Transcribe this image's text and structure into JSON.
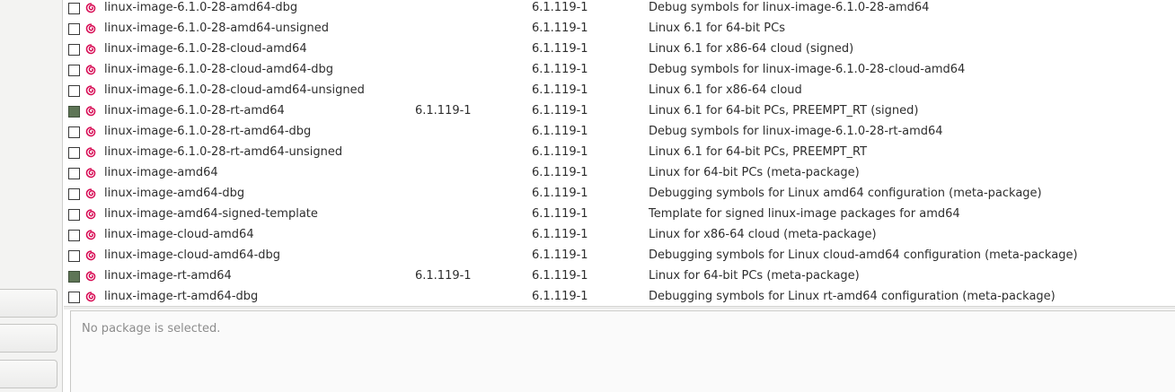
{
  "packages": [
    {
      "checked": false,
      "name": "linux-image-6.1.0-28-amd64-dbg",
      "installed": "",
      "latest": "6.1.119-1",
      "description": "Debug symbols for linux-image-6.1.0-28-amd64"
    },
    {
      "checked": false,
      "name": "linux-image-6.1.0-28-amd64-unsigned",
      "installed": "",
      "latest": "6.1.119-1",
      "description": "Linux 6.1 for 64-bit PCs"
    },
    {
      "checked": false,
      "name": "linux-image-6.1.0-28-cloud-amd64",
      "installed": "",
      "latest": "6.1.119-1",
      "description": "Linux 6.1 for x86-64 cloud (signed)"
    },
    {
      "checked": false,
      "name": "linux-image-6.1.0-28-cloud-amd64-dbg",
      "installed": "",
      "latest": "6.1.119-1",
      "description": "Debug symbols for linux-image-6.1.0-28-cloud-amd64"
    },
    {
      "checked": false,
      "name": "linux-image-6.1.0-28-cloud-amd64-unsigned",
      "installed": "",
      "latest": "6.1.119-1",
      "description": "Linux 6.1 for x86-64 cloud"
    },
    {
      "checked": true,
      "name": "linux-image-6.1.0-28-rt-amd64",
      "installed": "6.1.119-1",
      "latest": "6.1.119-1",
      "description": "Linux 6.1 for 64-bit PCs, PREEMPT_RT (signed)"
    },
    {
      "checked": false,
      "name": "linux-image-6.1.0-28-rt-amd64-dbg",
      "installed": "",
      "latest": "6.1.119-1",
      "description": "Debug symbols for linux-image-6.1.0-28-rt-amd64"
    },
    {
      "checked": false,
      "name": "linux-image-6.1.0-28-rt-amd64-unsigned",
      "installed": "",
      "latest": "6.1.119-1",
      "description": "Linux 6.1 for 64-bit PCs, PREEMPT_RT"
    },
    {
      "checked": false,
      "name": "linux-image-amd64",
      "installed": "",
      "latest": "6.1.119-1",
      "description": "Linux for 64-bit PCs (meta-package)"
    },
    {
      "checked": false,
      "name": "linux-image-amd64-dbg",
      "installed": "",
      "latest": "6.1.119-1",
      "description": "Debugging symbols for Linux amd64 configuration (meta-package)"
    },
    {
      "checked": false,
      "name": "linux-image-amd64-signed-template",
      "installed": "",
      "latest": "6.1.119-1",
      "description": "Template for signed linux-image packages for amd64"
    },
    {
      "checked": false,
      "name": "linux-image-cloud-amd64",
      "installed": "",
      "latest": "6.1.119-1",
      "description": "Linux for x86-64 cloud (meta-package)"
    },
    {
      "checked": false,
      "name": "linux-image-cloud-amd64-dbg",
      "installed": "",
      "latest": "6.1.119-1",
      "description": "Debugging symbols for Linux cloud-amd64 configuration (meta-package)"
    },
    {
      "checked": true,
      "name": "linux-image-rt-amd64",
      "installed": "6.1.119-1",
      "latest": "6.1.119-1",
      "description": "Linux for 64-bit PCs (meta-package)"
    },
    {
      "checked": false,
      "name": "linux-image-rt-amd64-dbg",
      "installed": "",
      "latest": "6.1.119-1",
      "description": "Debugging symbols for Linux rt-amd64 configuration (meta-package)"
    }
  ],
  "details": {
    "empty_text": "No package is selected."
  },
  "colors": {
    "checked_fill": "#5e7556",
    "debian_red": "#d70a53"
  },
  "icons": {
    "package_source": "debian-swirl-icon"
  }
}
